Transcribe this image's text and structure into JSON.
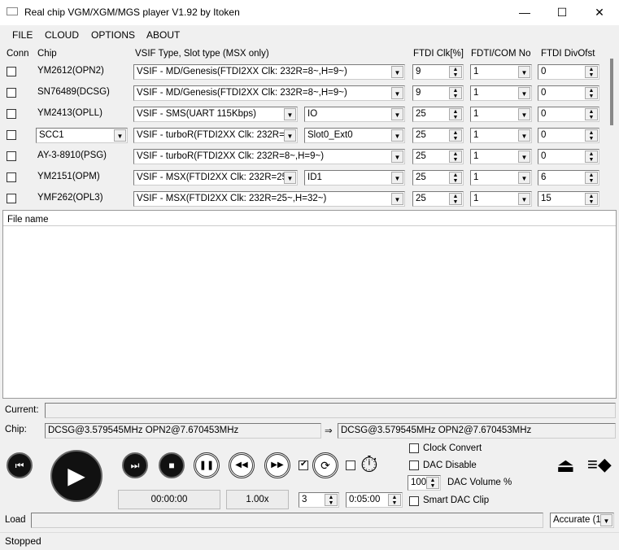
{
  "window": {
    "title": "Real chip VGM/XGM/MGS player V1.92 by Itoken",
    "minimize": "—",
    "maximize": "☐",
    "close": "✕"
  },
  "menu": [
    "FILE",
    "CLOUD",
    "OPTIONS",
    "ABOUT"
  ],
  "headers": {
    "conn": "Conn",
    "chip": "Chip",
    "vsif": "VSIF Type, Slot type (MSX only)",
    "clk": "FTDI Clk[%]",
    "com": "FDTI/COM No",
    "div": "FTDI DivOfst"
  },
  "rows": [
    {
      "chip": "YM2612(OPN2)",
      "vsif": "VSIF - MD/Genesis(FTDI2XX Clk: 232R=8~,H=9~)",
      "slot": null,
      "clk": "9",
      "com": "1",
      "div": "0"
    },
    {
      "chip": "SN76489(DCSG)",
      "vsif": "VSIF - MD/Genesis(FTDI2XX Clk: 232R=8~,H=9~)",
      "slot": null,
      "clk": "9",
      "com": "1",
      "div": "0"
    },
    {
      "chip": "YM2413(OPLL)",
      "vsif": "VSIF - SMS(UART 115Kbps)",
      "slot": "IO",
      "clk": "25",
      "com": "1",
      "div": "0"
    },
    {
      "chip": "SCC1",
      "chipCombo": true,
      "vsif": "VSIF - turboR(FTDI2XX Clk: 232R=",
      "slot": "Slot0_Ext0",
      "clk": "25",
      "com": "1",
      "div": "0"
    },
    {
      "chip": "AY-3-8910(PSG)",
      "vsif": "VSIF - turboR(FTDI2XX Clk: 232R=8~,H=9~)",
      "slot": null,
      "clk": "25",
      "com": "1",
      "div": "0"
    },
    {
      "chip": "YM2151(OPM)",
      "vsif": "VSIF - MSX(FTDI2XX Clk: 232R=25",
      "slot": "ID1",
      "clk": "25",
      "com": "1",
      "div": "6"
    },
    {
      "chip": "YMF262(OPL3)",
      "vsif": "VSIF - MSX(FTDI2XX Clk: 232R=25~,H=32~)",
      "slot": null,
      "clk": "25",
      "com": "1",
      "div": "15"
    }
  ],
  "filelist": {
    "header": "File name"
  },
  "current": {
    "label": "Current:",
    "value": ""
  },
  "chipinfo": {
    "label": "Chip:",
    "value": "DCSG@3.579545MHz OPN2@7.670453MHz",
    "arrow": "⇒",
    "converted": "DCSG@3.579545MHz OPN2@7.670453MHz"
  },
  "player": {
    "time": "00:00:00",
    "speed": "1.00x",
    "loop_count": "3",
    "loop_checked": true,
    "timer_checked": false,
    "timer": "0:05:00"
  },
  "options": {
    "clock_convert": "Clock Convert",
    "dac_disable": "DAC Disable",
    "dac_volume": "100",
    "dac_volume_label": "DAC Volume %",
    "smart_dac": "Smart DAC Clip"
  },
  "load": {
    "label": "Load",
    "value": "",
    "mode": "Accurate (1"
  },
  "status": "Stopped"
}
